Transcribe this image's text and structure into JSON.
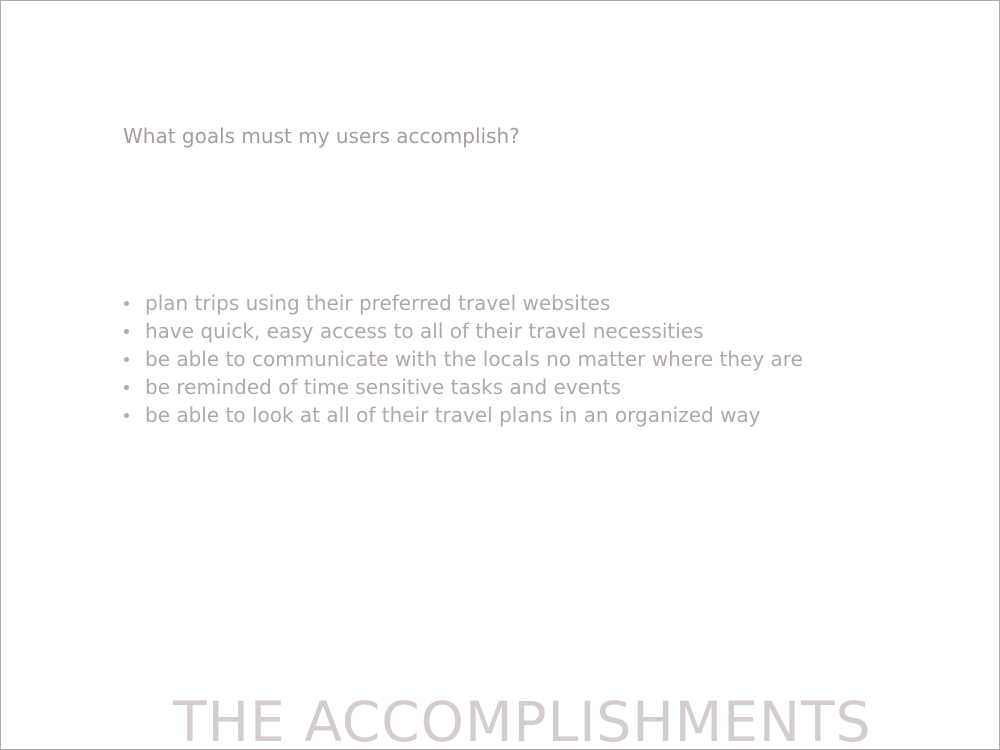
{
  "slide": {
    "question": "What goals must my users accomplish?",
    "goals": [
      "plan trips using their preferred travel websites",
      "have quick, easy access to all of their travel necessities",
      "be able to communicate with the locals no matter where they are",
      "be reminded of time sensitive tasks and events",
      "be able to look at all of their travel plans in an organized way"
    ],
    "section_title": "THE ACCOMPLISHMENTS"
  },
  "colors": {
    "border": "#b3a8aa",
    "body_text": "#b0a8a9",
    "title_text": "#d4cdce"
  }
}
